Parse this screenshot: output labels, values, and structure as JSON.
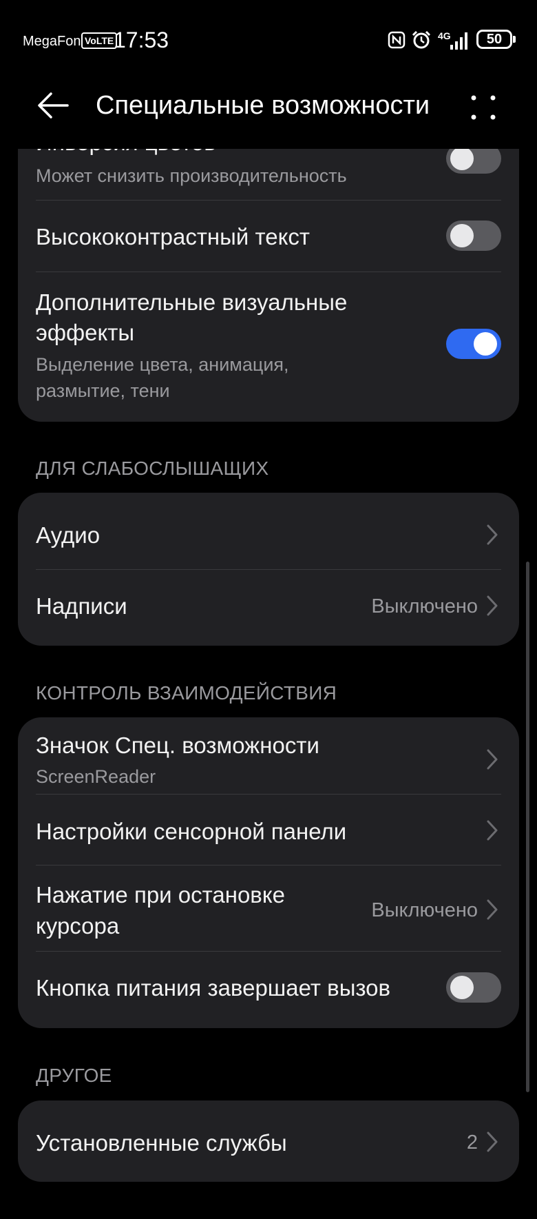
{
  "status_bar": {
    "carrier": "MegaFon",
    "volte": "VoLTE",
    "time": "17:53",
    "network": "4G",
    "battery": "50"
  },
  "header": {
    "title": "Специальные возможности"
  },
  "display_card": {
    "partial_title": "Инверсия цветов",
    "partial_subtitle": "Может снизить производительность",
    "partial_toggle_on": false,
    "high_contrast": {
      "label": "Высококонтрастный текст",
      "on": false
    },
    "visual_effects": {
      "label_line1": "Дополнительные визуальные",
      "label_line2": "эффекты",
      "sub_line1": "Выделение цвета, анимация,",
      "sub_line2": "размытие, тени",
      "on": true
    }
  },
  "hearing": {
    "header": "ДЛЯ СЛАБОСЛЫШАЩИХ",
    "audio": {
      "label": "Аудио"
    },
    "captions": {
      "label": "Надписи",
      "value": "Выключено"
    }
  },
  "interaction": {
    "header": "КОНТРОЛЬ ВЗАИМОДЕЙСТВИЯ",
    "shortcut": {
      "label": "Значок Спец. возможности",
      "sub": "ScreenReader"
    },
    "touchpad": {
      "label": "Настройки сенсорной панели"
    },
    "dwell": {
      "label_line1": "Нажатие при остановке",
      "label_line2": "курсора",
      "value": "Выключено"
    },
    "power_ends_call": {
      "label": "Кнопка питания завершает вызов",
      "on": false
    }
  },
  "other": {
    "header": "ДРУГОЕ",
    "installed": {
      "label": "Установленные службы",
      "value": "2"
    }
  },
  "colors": {
    "accent": "#2f6af1",
    "card": "#212124",
    "background": "#000000"
  }
}
